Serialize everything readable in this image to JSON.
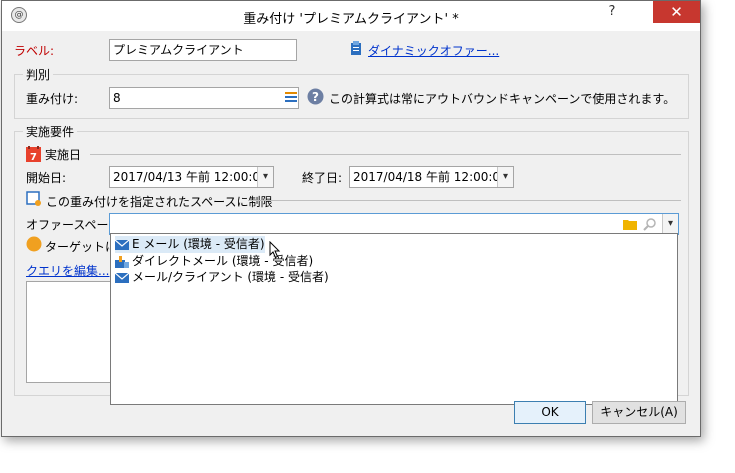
{
  "window": {
    "title": "重み付け 'プレミアムクライアント' *",
    "help_label": "?",
    "close_label": "✕"
  },
  "label_field": {
    "label": "ラベル:",
    "value": "プレミアムクライアント"
  },
  "dynamic_offer_link": "ダイナミックオファー...",
  "judgement": {
    "group_title": "判別",
    "weight_label": "重み付け:",
    "weight_value": "8",
    "info_text": "この計算式は常にアウトバウンドキャンペーンで使用されます。"
  },
  "requirements": {
    "group_title": "実施要件",
    "section_title": "実施日",
    "calendar_day": "7",
    "start_label": "開始日:",
    "start_value": "2017/04/13 午前 12:00:00",
    "end_label": "終了日:",
    "end_value": "2017/04/18 午前 12:00:00",
    "restrict_label": "この重み付けを指定されたスペースに制限",
    "offer_space_label": "オファースペース:",
    "offer_space_value": "",
    "target_label": "ターゲットに対",
    "edit_query_link": "クエリを編集..."
  },
  "dropdown": {
    "items": [
      {
        "label": "E メール (環境 - 受信者)",
        "icon": "email-icon"
      },
      {
        "label": "ダイレクトメール (環境 - 受信者)",
        "icon": "direct-mail-icon"
      },
      {
        "label": "メール/クライアント (環境 - 受信者)",
        "icon": "email-icon"
      }
    ]
  },
  "buttons": {
    "ok": "OK",
    "cancel": "キャンセル(A)"
  },
  "colors": {
    "close_button": "#c7372f",
    "required_label": "#c00000",
    "link": "#0033cc",
    "dropdown_hover": "#dbeaf7"
  }
}
